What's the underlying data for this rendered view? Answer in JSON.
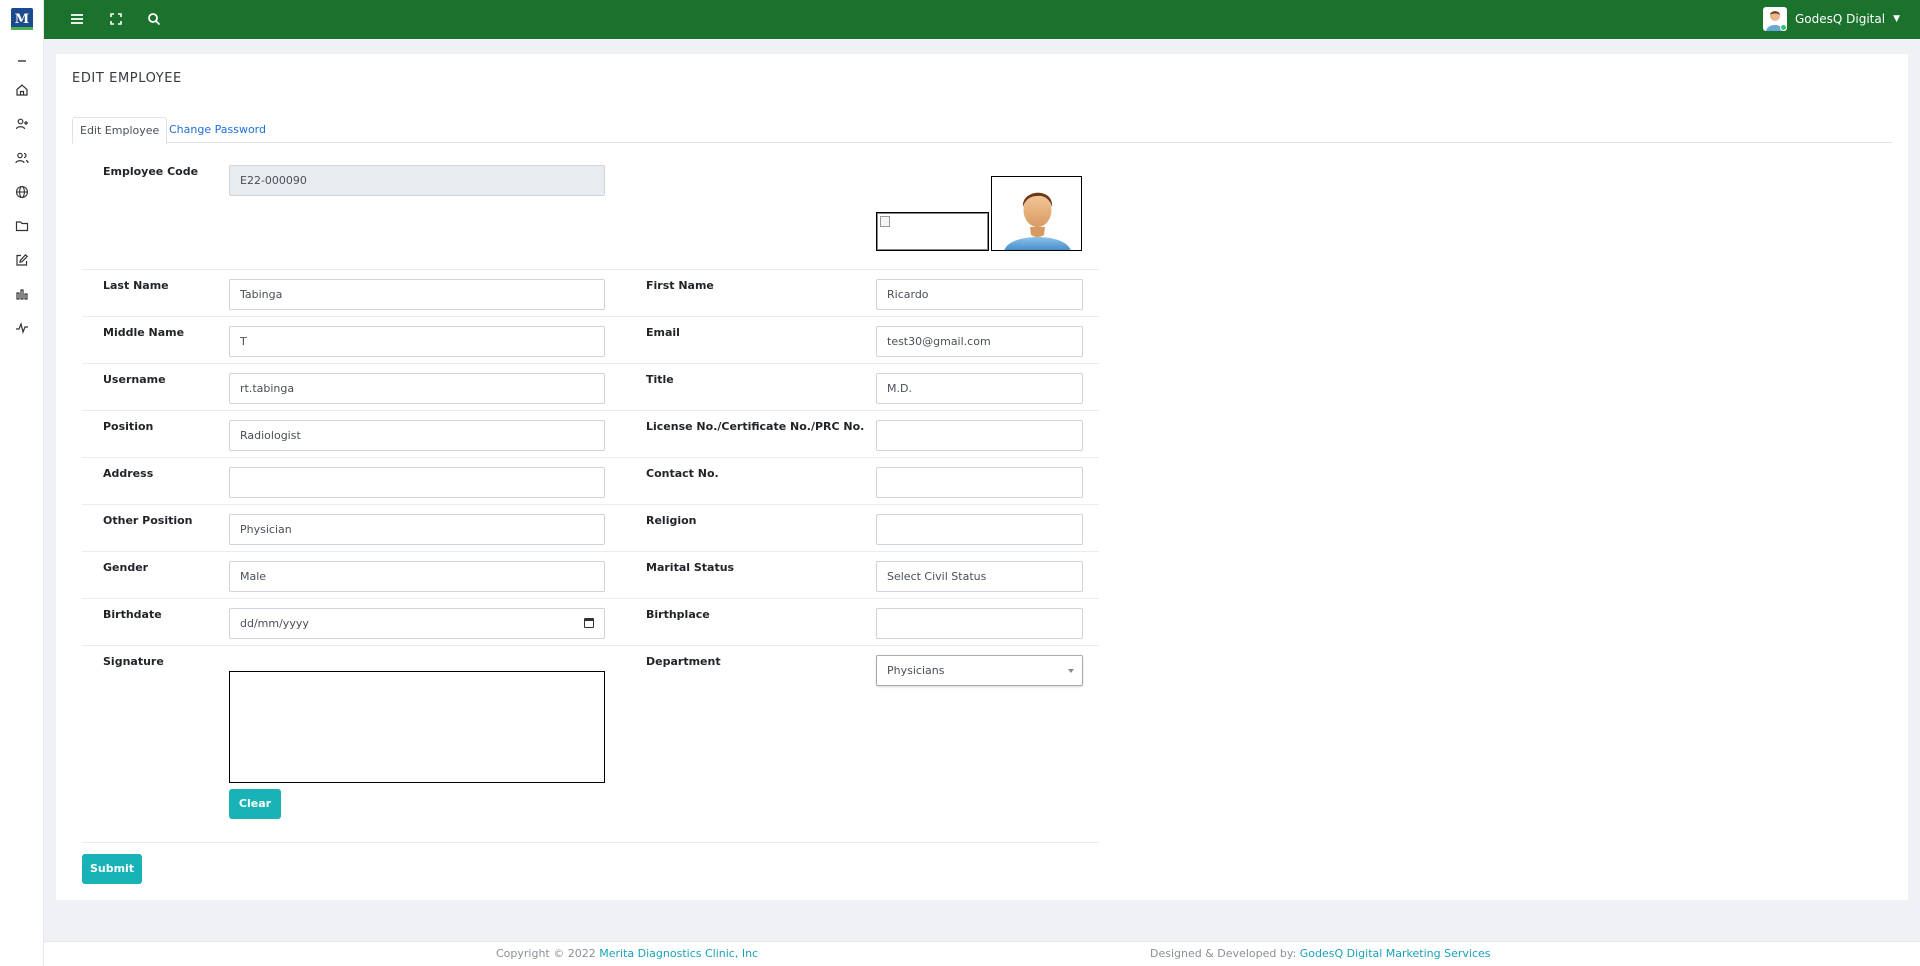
{
  "topbar": {
    "user_name": "GodesQ Digital",
    "accent_color": "#1b722d"
  },
  "sidebar": {
    "icons": [
      "minus-icon",
      "home-icon",
      "add-user-icon",
      "users-icon",
      "globe-icon",
      "folder-icon",
      "edit-icon",
      "bar-chart-icon",
      "activity-icon"
    ]
  },
  "page": {
    "title": "EDIT EMPLOYEE",
    "tabs": [
      {
        "label": "Edit Employee",
        "active": true
      },
      {
        "label": "Change Password",
        "active": false
      }
    ]
  },
  "form": {
    "employee_code": {
      "label": "Employee Code",
      "value": "E22-000090"
    },
    "last_name": {
      "label": "Last Name",
      "value": "Tabinga"
    },
    "first_name": {
      "label": "First Name",
      "value": "Ricardo"
    },
    "middle_name": {
      "label": "Middle Name",
      "value": "T"
    },
    "email": {
      "label": "Email",
      "value": "test30@gmail.com"
    },
    "username": {
      "label": "Username",
      "value": "rt.tabinga"
    },
    "title": {
      "label": "Title",
      "value": "M.D."
    },
    "position": {
      "label": "Position",
      "value": "Radiologist"
    },
    "license": {
      "label": "License No./Certificate No./PRC No.",
      "value": ""
    },
    "address": {
      "label": "Address",
      "value": ""
    },
    "contact": {
      "label": "Contact No.",
      "value": ""
    },
    "other_position": {
      "label": "Other Position",
      "value": "Physician"
    },
    "religion": {
      "label": "Religion",
      "value": ""
    },
    "gender": {
      "label": "Gender",
      "value": "Male"
    },
    "marital_status": {
      "label": "Marital Status",
      "value": "Select Civil Status"
    },
    "birthdate": {
      "label": "Birthdate",
      "value": "dd/mm/yyyy"
    },
    "birthplace": {
      "label": "Birthplace",
      "value": ""
    },
    "signature": {
      "label": "Signature"
    },
    "department": {
      "label": "Department",
      "value": "Physicians"
    },
    "clear_label": "Clear",
    "submit_label": "Submit",
    "button_color": "#17b3b7"
  },
  "footer": {
    "copyright_prefix": "Copyright © 2022",
    "copyright_link": "Merita Diagnostics Clinic, Inc",
    "designed_prefix": "Designed & Developed by:",
    "designed_link": "GodesQ Digital Marketing Services"
  }
}
